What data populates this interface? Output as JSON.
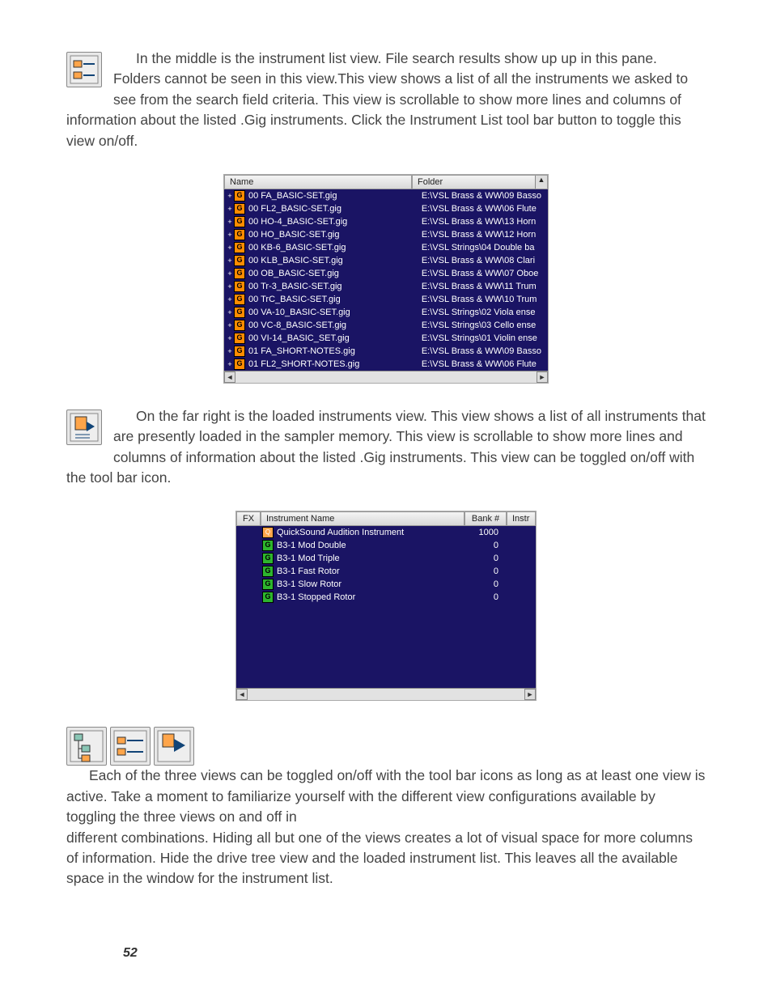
{
  "para1": "In the middle is the instrument list view. File search results show up up in this pane. Folders cannot be seen in this view.This view shows a list of all the instruments we asked to see from the search field criteria. This view is scrollable to show more lines and columns of information about the listed .Gig instruments. Click the Instrument List tool bar button to toggle this view on/off.",
  "para2": "On the far right is the loaded instruments view. This view shows a list of all instruments that are presently loaded in the sampler memory. This view is scrollable to show more lines and columns of information about the listed .Gig instruments. This view can be toggled on/off with the tool bar icon.",
  "para3a": "Each of the three views can be toggled on/off with the tool bar icons as long as at least one view is active. Take a moment to familiarize yourself with the different view configurations available by toggling the three views on and off in ",
  "para3b": "different combinations. Hiding all but one of the views creates a lot of visual space for more columns of information. Hide the drive tree view and the loaded instrument list. This leaves all the available space in the window for the instrument list.",
  "page_number": "52",
  "fig1": {
    "headers": {
      "name": "Name",
      "folder": "Folder"
    },
    "rows": [
      {
        "name": "00 FA_BASIC-SET.gig",
        "folder": "E:\\VSL Brass & WW\\09 Basso"
      },
      {
        "name": "00 FL2_BASIC-SET.gig",
        "folder": "E:\\VSL Brass & WW\\06 Flute"
      },
      {
        "name": "00 HO-4_BASIC-SET.gig",
        "folder": "E:\\VSL Brass & WW\\13 Horn"
      },
      {
        "name": "00 HO_BASIC-SET.gig",
        "folder": "E:\\VSL Brass & WW\\12 Horn"
      },
      {
        "name": "00 KB-6_BASIC-SET.gig",
        "folder": "E:\\VSL Strings\\04 Double ba"
      },
      {
        "name": "00 KLB_BASIC-SET.gig",
        "folder": "E:\\VSL Brass & WW\\08 Clari"
      },
      {
        "name": "00 OB_BASIC-SET.gig",
        "folder": "E:\\VSL Brass & WW\\07 Oboe"
      },
      {
        "name": "00 Tr-3_BASIC-SET.gig",
        "folder": "E:\\VSL Brass & WW\\11 Trum"
      },
      {
        "name": "00 TrC_BASIC-SET.gig",
        "folder": "E:\\VSL Brass & WW\\10 Trum"
      },
      {
        "name": "00 VA-10_BASIC-SET.gig",
        "folder": "E:\\VSL Strings\\02 Viola ense"
      },
      {
        "name": "00 VC-8_BASIC-SET.gig",
        "folder": "E:\\VSL Strings\\03 Cello ense"
      },
      {
        "name": "00 VI-14_BASIC_SET.gig",
        "folder": "E:\\VSL Strings\\01 Violin ense"
      },
      {
        "name": "01 FA_SHORT-NOTES.gig",
        "folder": "E:\\VSL Brass & WW\\09 Basso"
      },
      {
        "name": "01 FL2_SHORT-NOTES.gig",
        "folder": "E:\\VSL Brass & WW\\06 Flute"
      }
    ]
  },
  "fig2": {
    "headers": {
      "fx": "FX",
      "name": "Instrument Name",
      "bank": "Bank #",
      "instr": "Instr"
    },
    "rows": [
      {
        "kind": "q",
        "name": "QuickSound Audition Instrument",
        "bank": "1000"
      },
      {
        "kind": "g",
        "name": "B3-1 Mod Double",
        "bank": "0"
      },
      {
        "kind": "g",
        "name": "B3-1 Mod Triple",
        "bank": "0"
      },
      {
        "kind": "g",
        "name": "B3-1 Fast Rotor",
        "bank": "0"
      },
      {
        "kind": "g",
        "name": "B3-1 Slow Rotor",
        "bank": "0"
      },
      {
        "kind": "g",
        "name": "B3-1 Stopped Rotor",
        "bank": "0"
      }
    ]
  }
}
